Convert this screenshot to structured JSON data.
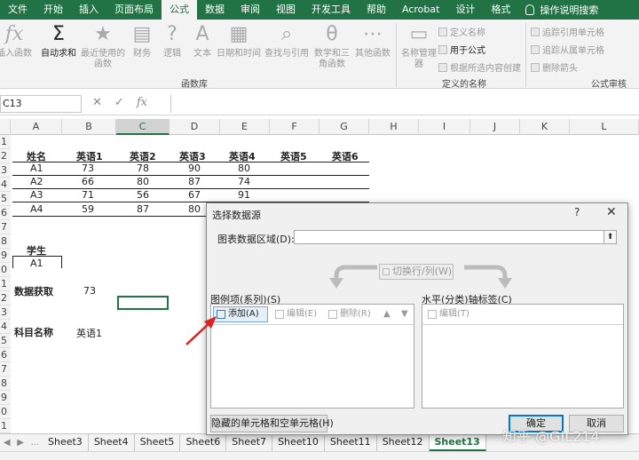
{
  "ribbon_tabs": [
    "文件",
    "开始",
    "插入",
    "页面布局",
    "公式",
    "数据",
    "审阅",
    "视图",
    "开发工具",
    "帮助",
    "Acrobat",
    "设计",
    "格式"
  ],
  "active_tab": "公式",
  "tell_me": "操作说明搜索",
  "ribbon": {
    "insert_function": "插入函数",
    "autosum": "自动求和",
    "recent": "最近使用的函数",
    "financial": "财务",
    "logical": "逻辑",
    "text": "文本",
    "datetime": "日期和时间",
    "lookup": "查找与引用",
    "math": "数学和三角函数",
    "more": "其他函数",
    "group_library": "函数库",
    "name_manager": "名称管理器",
    "define_name": "定义名称",
    "use_in_formula": "用于公式",
    "create_from_selection": "根据所选内容创建",
    "group_names": "定义的名称",
    "trace_precedents": "追踪引用单元格",
    "trace_dependents": "追踪从属单元格",
    "remove_arrows": "删除箭头",
    "group_audit": "公式审核"
  },
  "formula_bar": {
    "name_box": "C13",
    "fx": "fx",
    "cancel": "✕",
    "enter": "✓"
  },
  "columns": [
    "A",
    "B",
    "C",
    "D",
    "E",
    "F",
    "G",
    "H",
    "I",
    "J",
    "K",
    "L"
  ],
  "selected_column": "C",
  "rows": [
    "1",
    "2",
    "3",
    "4",
    "5",
    "6",
    "7",
    "8",
    "9",
    "0",
    "1",
    "2",
    "3",
    "4",
    "5",
    "6",
    "7",
    "8",
    "9",
    "0",
    "1"
  ],
  "table": {
    "header": [
      "姓名",
      "英语1",
      "英语2",
      "英语3",
      "英语4",
      "英语5",
      "英语6"
    ],
    "rows": [
      [
        "A1",
        "73",
        "78",
        "90",
        "80"
      ],
      [
        "A2",
        "66",
        "80",
        "87",
        "74"
      ],
      [
        "A3",
        "71",
        "56",
        "67",
        "91"
      ],
      [
        "A4",
        "59",
        "87",
        "80",
        ""
      ]
    ]
  },
  "lookup": {
    "student_label": "学生",
    "student_value": "A1",
    "data_label": "数据获取",
    "data_value": "73",
    "subject_label": "科目名称",
    "subject_value": "英语1"
  },
  "sheets": [
    "Sheet3",
    "Sheet4",
    "Sheet5",
    "Sheet6",
    "Sheet7",
    "Sheet10",
    "Sheet11",
    "Sheet12",
    "Sheet13"
  ],
  "active_sheet": "Sheet13",
  "sheet_nav": {
    "prev": "◀",
    "next": "▶",
    "more": "..."
  },
  "dialog": {
    "title": "选择数据源",
    "help": "?",
    "close": "✕",
    "range_label": "图表数据区域(D):",
    "range_value": "",
    "collapse": "⬆",
    "switch": "切换行/列(W)",
    "legend_label": "图例项(系列)(S)",
    "add": "添加(A)",
    "edit": "编辑(E)",
    "delete": "删除(R)",
    "up": "▲",
    "down": "▼",
    "axis_label": "水平(分类)轴标签(C)",
    "axis_edit": "编辑(T)",
    "hidden_cells": "隐藏的单元格和空单元格(H)",
    "ok": "确定",
    "cancel": "取消"
  },
  "watermark": "知乎 @GIL214",
  "colors": {
    "excel_green": "#217346",
    "annotation_arrow": "#e02020"
  }
}
